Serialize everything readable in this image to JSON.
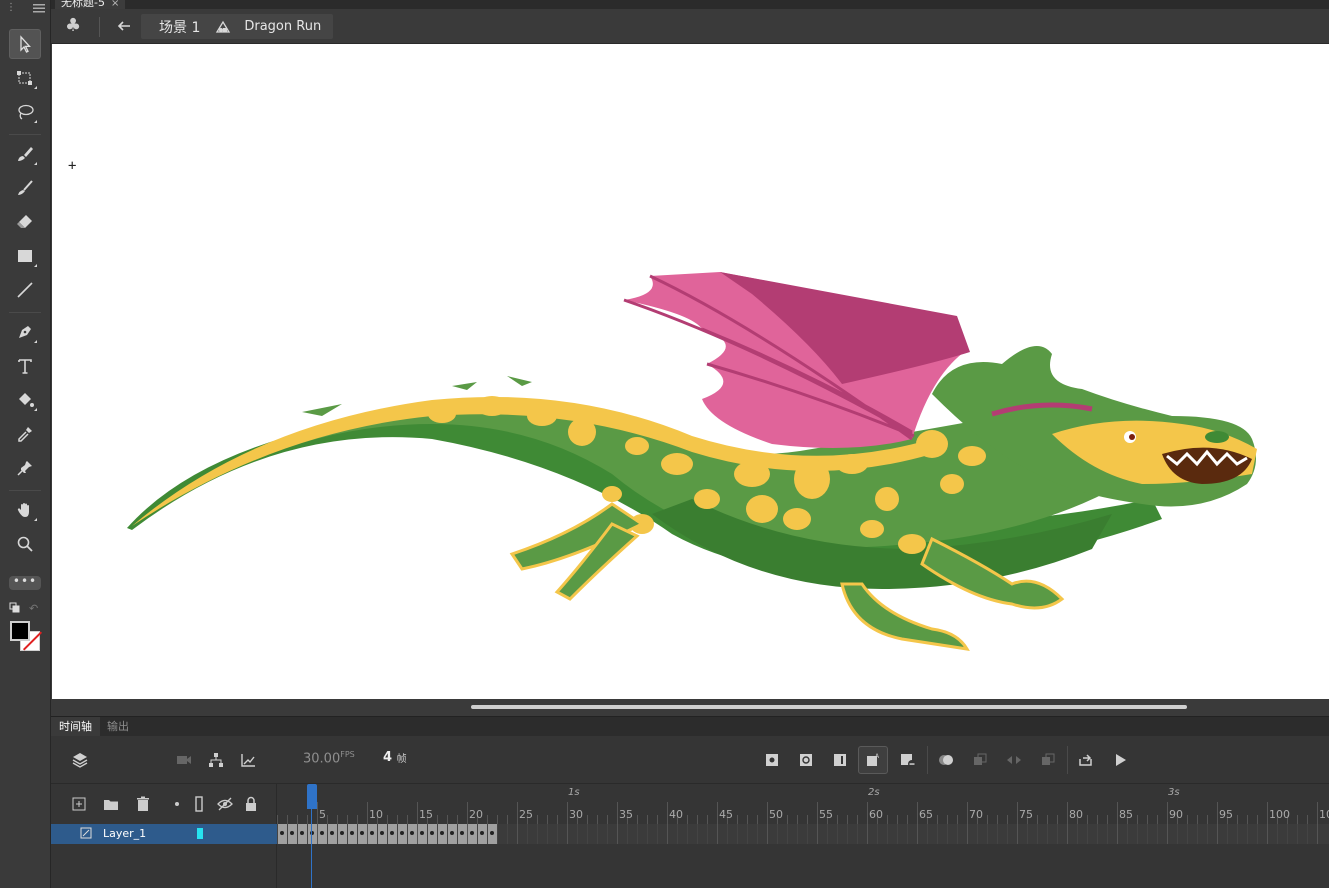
{
  "document": {
    "tab_title": "无标题-5",
    "close": "×"
  },
  "editbar": {
    "scene": "场景 1",
    "symbol": "Dragon Run"
  },
  "toolbar": {
    "tools": [
      "selection",
      "free-transform",
      "lasso",
      "paint-brush",
      "brush",
      "eraser",
      "rectangle",
      "line",
      "pen",
      "text",
      "paint-bucket",
      "eyedropper",
      "pin",
      "hand",
      "zoom"
    ],
    "more": "•••",
    "stroke_color": "#000000",
    "fill_color": "none"
  },
  "stage": {
    "reg_mark": "+"
  },
  "panel": {
    "tabs": [
      {
        "label": "时间轴",
        "active": true
      },
      {
        "label": "输出",
        "active": false
      }
    ],
    "fps": "30.00",
    "fps_unit": "FPS",
    "current_frame": "4",
    "frame_unit": "帧",
    "filled_frames": 22,
    "seconds": [
      "1s",
      "2s",
      "3s"
    ],
    "ruler_numbers": [
      "5",
      "10",
      "15",
      "20",
      "25",
      "30",
      "35",
      "40",
      "45",
      "50",
      "55",
      "60",
      "65",
      "70",
      "75",
      "80",
      "85",
      "90",
      "95",
      "100",
      "10"
    ]
  },
  "layers": [
    {
      "name": "Layer_1",
      "color": "#27e3f0",
      "selected": true
    }
  ]
}
